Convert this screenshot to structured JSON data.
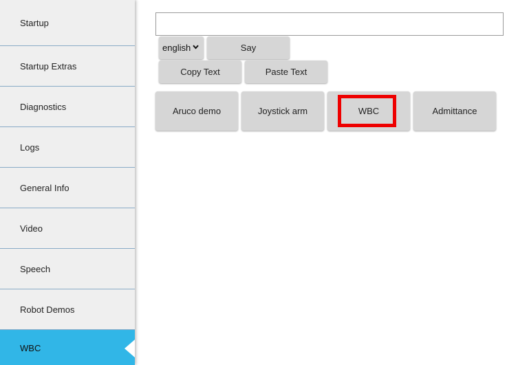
{
  "sidebar": {
    "items": [
      {
        "label": "Startup"
      },
      {
        "label": "Startup Extras"
      },
      {
        "label": "Diagnostics"
      },
      {
        "label": "Logs"
      },
      {
        "label": "General Info"
      },
      {
        "label": "Video"
      },
      {
        "label": "Speech"
      },
      {
        "label": "Robot Demos"
      },
      {
        "label": "WBC",
        "active": true
      }
    ]
  },
  "speech": {
    "text_value": "",
    "language": "english",
    "say_label": "Say",
    "copy_label": "Copy Text",
    "paste_label": "Paste Text"
  },
  "demos": {
    "buttons": [
      {
        "label": "Aruco demo"
      },
      {
        "label": "Joystick arm"
      },
      {
        "label": "WBC",
        "highlighted": true
      },
      {
        "label": "Admittance"
      }
    ]
  },
  "colors": {
    "sidebar_bg": "#efefef",
    "active_item": "#31b6e7",
    "divider": "#88aac6",
    "button_bg": "#d6d6d6",
    "highlight": "#ee0000"
  }
}
